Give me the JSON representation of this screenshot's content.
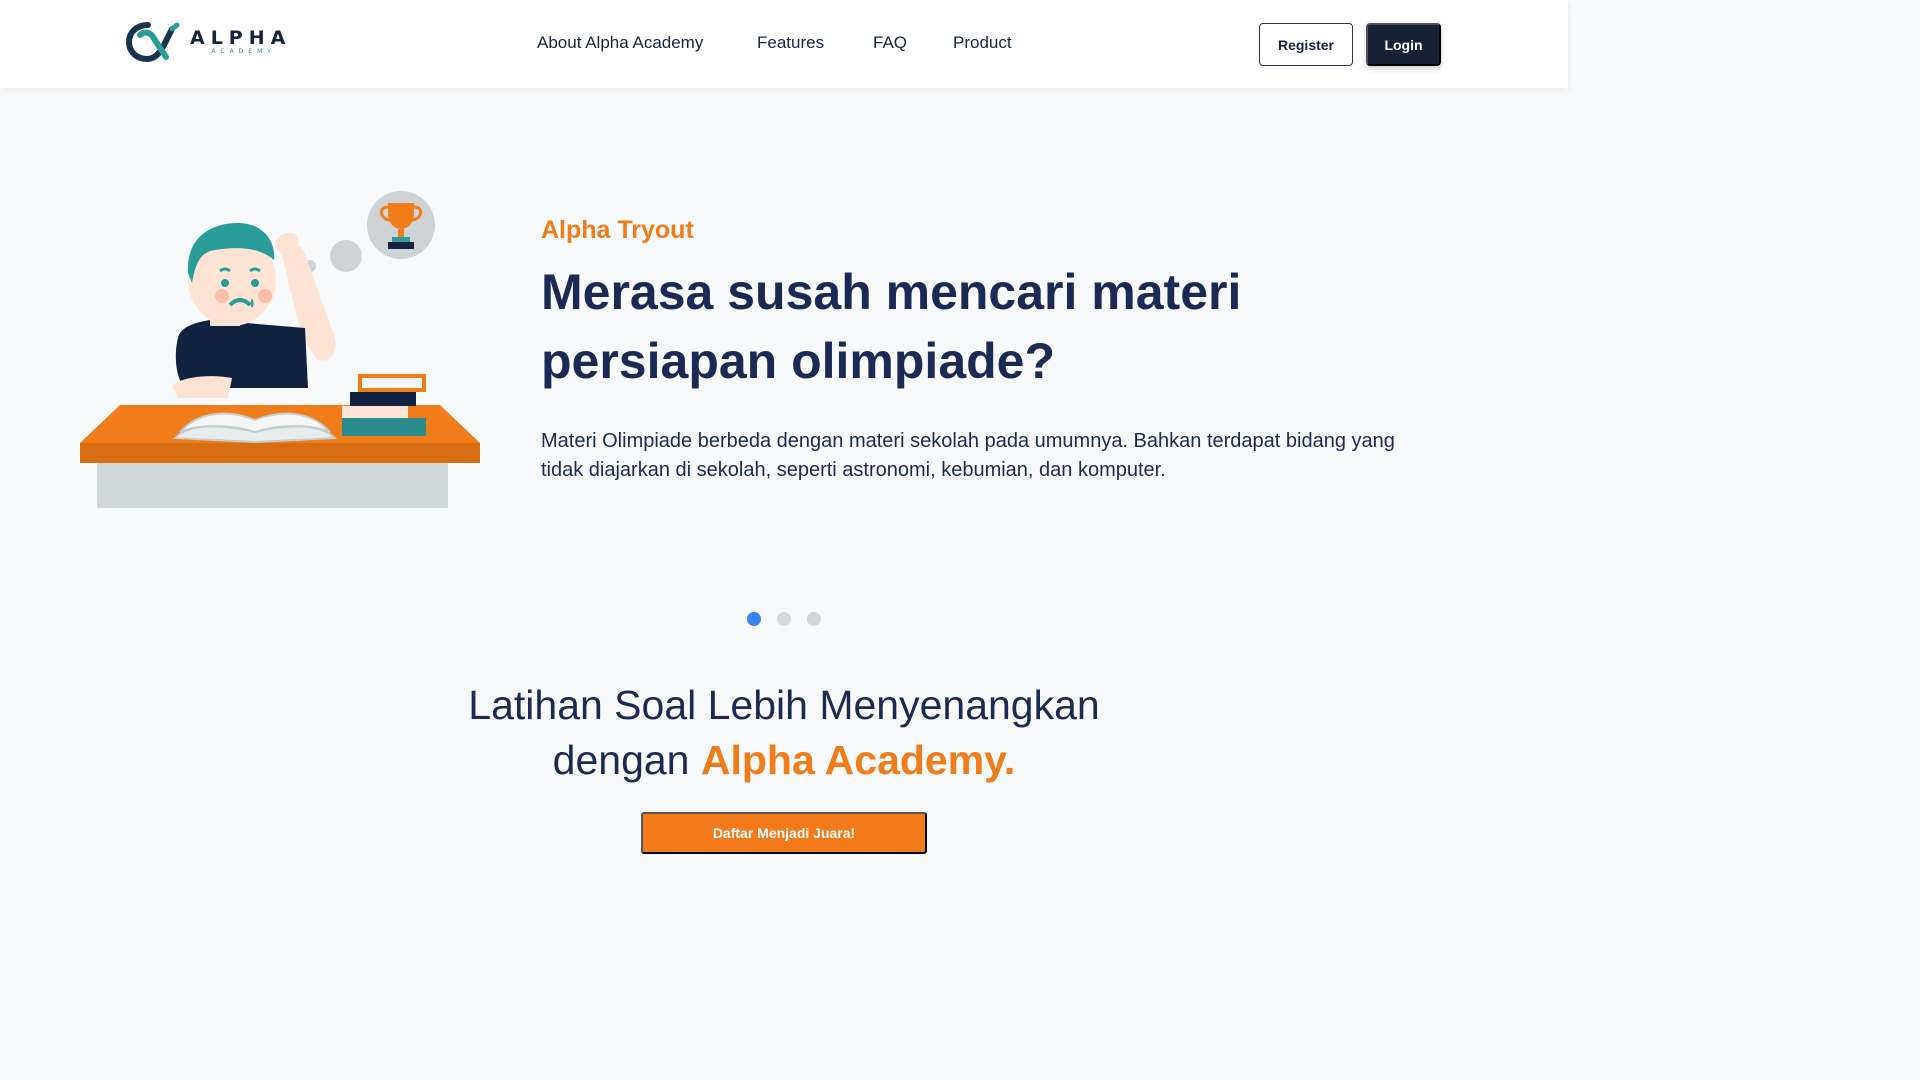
{
  "brand": {
    "name": "ALPHA",
    "tagline": "ACADEMY",
    "logo_icon": "alpha-x-logo-icon"
  },
  "nav": {
    "items": [
      "About Alpha Academy",
      "Features",
      "FAQ",
      "Product"
    ]
  },
  "auth": {
    "register_label": "Register",
    "login_label": "Login"
  },
  "hero": {
    "eyebrow": "Alpha Tryout",
    "title": "Merasa susah mencari materi persiapan olimpiade?",
    "description": "Materi Olimpiade berbeda dengan materi sekolah pada umumnya. Bahkan terdapat bidang yang tidak diajarkan di sekolah, seperti astronomi, kebumian, dan komputer.",
    "illustration": "student-studying-trophy-illustration"
  },
  "carousel": {
    "slide_count": 3,
    "active_index": 0
  },
  "cta": {
    "line1": "Latihan Soal Lebih Menyenangkan",
    "line2_prefix": "dengan ",
    "line2_highlight": "Alpha Academy.",
    "button_label": "Daftar Menjadi Juara!"
  },
  "colors": {
    "accent_orange": "#f07d1a",
    "navy": "#1b2a55",
    "dark_button": "#172135",
    "active_dot": "#3b82f6",
    "inactive_dot": "#d3d6da"
  }
}
